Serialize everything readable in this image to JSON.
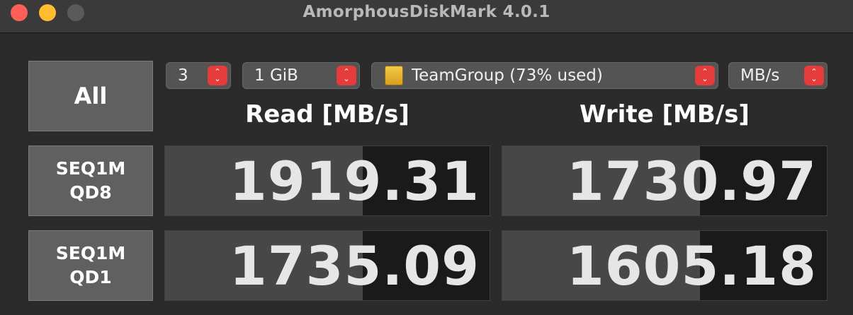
{
  "window": {
    "title": "AmorphousDiskMark 4.0.1"
  },
  "controls": {
    "all_label": "All",
    "count": "3",
    "size": "1 GiB",
    "drive": "TeamGroup (73% used)",
    "unit": "MB/s"
  },
  "headers": {
    "read": "Read [MB/s]",
    "write": "Write [MB/s]"
  },
  "tests": [
    {
      "line1": "SEQ1M",
      "line2": "QD8",
      "read": "1919.31",
      "write": "1730.97",
      "read_fill": 0.61,
      "write_fill": 0.61
    },
    {
      "line1": "SEQ1M",
      "line2": "QD1",
      "read": "1735.09",
      "write": "1605.18",
      "read_fill": 0.61,
      "write_fill": 0.61
    }
  ],
  "colors": {
    "stepper": "#e63b3b",
    "tile": "#606060",
    "bar": "#474747"
  }
}
